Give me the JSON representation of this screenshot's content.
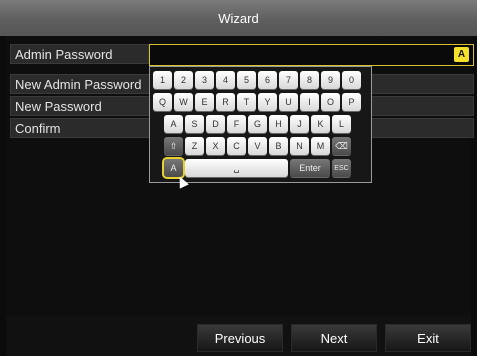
{
  "window": {
    "title": "Wizard"
  },
  "form": {
    "admin_password_label": "Admin Password",
    "new_admin_password_label": "New Admin Password",
    "new_password_label": "New Password",
    "confirm_label": "Confirm",
    "ime_badge": "A"
  },
  "keyboard": {
    "row1": [
      "1",
      "2",
      "3",
      "4",
      "5",
      "6",
      "7",
      "8",
      "9",
      "0"
    ],
    "row2": [
      "Q",
      "W",
      "E",
      "R",
      "T",
      "Y",
      "U",
      "I",
      "O",
      "P"
    ],
    "row3": [
      "A",
      "S",
      "D",
      "F",
      "G",
      "H",
      "J",
      "K",
      "L"
    ],
    "row4": [
      "Z",
      "X",
      "C",
      "V",
      "B",
      "N",
      "M"
    ],
    "enter": "Enter",
    "esc": "ESC",
    "space_glyph": "␣",
    "shift_glyph": "⇧",
    "backspace_glyph": "⌫",
    "mode_glyph": "A"
  },
  "buttons": {
    "previous": "Previous",
    "next": "Next",
    "exit": "Exit"
  },
  "colors": {
    "accent": "#f3e12c",
    "background": "#0b0b0b",
    "row_bg": "#2b2b2b"
  }
}
